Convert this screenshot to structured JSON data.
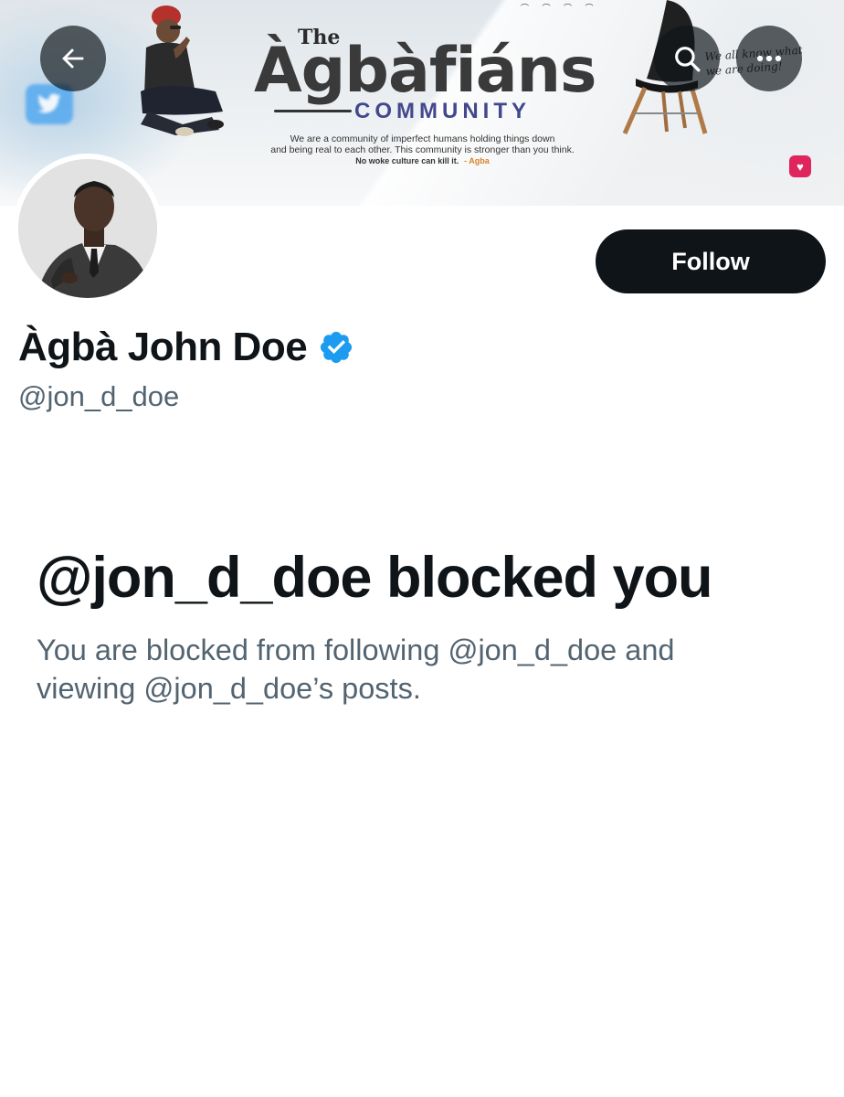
{
  "banner": {
    "brand_prefix": "The",
    "brand_name": "Àgbàfiáns",
    "brand_subtitle": "COMMUNITY",
    "tagline_line1": "We are a community of imperfect humans holding things down",
    "tagline_line2": "and being real to each other. This community is stronger than you think.",
    "tagline_line3": "No woke culture can kill it.",
    "tagline_author": "- Agba",
    "script_note": "We all know what we are doing!"
  },
  "header": {
    "back_icon": "arrow-left-icon",
    "search_icon": "search-icon",
    "more_icon": "more-horizontal-icon"
  },
  "profile": {
    "display_name": "Àgbà John Doe",
    "handle": "@jon_d_doe",
    "verified": true,
    "follow_label": "Follow"
  },
  "blocked": {
    "title": "@jon_d_doe blocked you",
    "description": "You are blocked from following @jon_d_doe and viewing @jon_d_doe’s posts."
  },
  "colors": {
    "text_primary": "#0f1419",
    "text_secondary": "#536471",
    "verified_blue": "#1d9bf0",
    "brand_purple": "#43488d",
    "button_dark": "#0f1419"
  }
}
